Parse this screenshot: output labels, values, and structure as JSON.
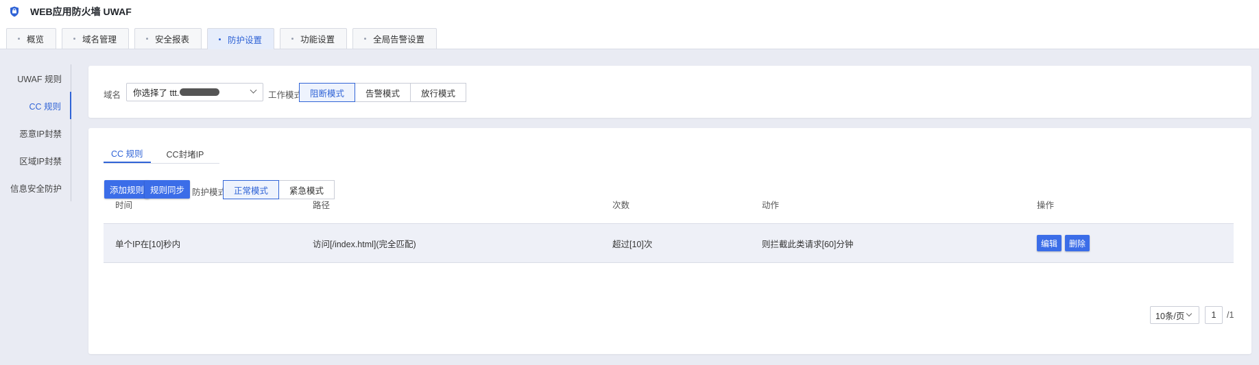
{
  "app": {
    "title": "WEB应用防火墙 UWAF",
    "icon": "shield-icon"
  },
  "tabs": [
    {
      "label": "概览"
    },
    {
      "label": "域名管理"
    },
    {
      "label": "安全报表"
    },
    {
      "label": "防护设置",
      "active": true
    },
    {
      "label": "功能设置"
    },
    {
      "label": "全局告警设置"
    }
  ],
  "sidebar": {
    "items": [
      {
        "label": "UWAF 规则"
      },
      {
        "label": "CC 规则",
        "active": true
      },
      {
        "label": "恶意IP封禁"
      },
      {
        "label": "区域IP封禁"
      },
      {
        "label": "信息安全防护"
      }
    ]
  },
  "filter": {
    "domain_label": "域名",
    "domain_value": "你选择了 ttt.",
    "work_mode_label": "工作模式:",
    "modes": [
      "阻断模式",
      "告警模式",
      "放行模式"
    ],
    "selected_mode": "阻断模式"
  },
  "rules": {
    "subtabs": [
      "CC 规则",
      "CC封堵IP"
    ],
    "add_label": "添加规则",
    "sync_label": "规则同步",
    "protect_mode_label": "防护模式:",
    "protect_modes": [
      "正常模式",
      "紧急模式"
    ],
    "selected_protect_mode": "正常模式",
    "columns": [
      "时间",
      "路径",
      "次数",
      "动作",
      "操作"
    ],
    "rows": [
      {
        "time": "单个IP在[10]秒内",
        "path": "访问[/index.html](完全匹配)",
        "count": "超过[10]次",
        "action": "则拦截此类请求[60]分钟",
        "edit_label": "编辑",
        "delete_label": "删除"
      }
    ]
  },
  "pagination": {
    "page_size": "10条/页",
    "page": "1",
    "total": "/1"
  },
  "colors": {
    "accent": "#2f63d6",
    "primary_button": "#3b6de8",
    "background": "#e9ebf3"
  }
}
